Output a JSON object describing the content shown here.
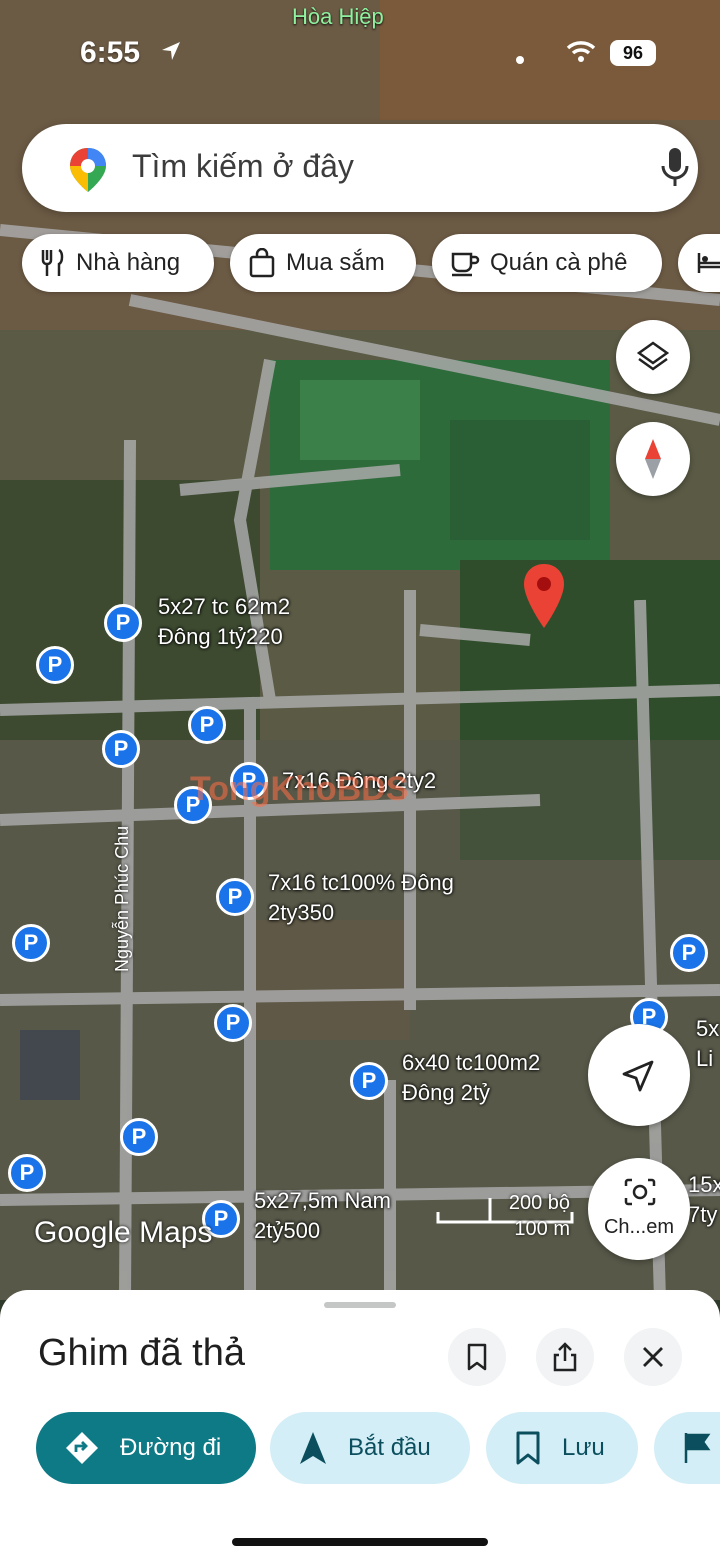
{
  "status_bar": {
    "time": "6:55",
    "battery": "96"
  },
  "map": {
    "top_place": "Hòa Hiệp",
    "road_label": "Nguyễn Phúc Chu",
    "watermark": "TongKhoBDS",
    "attribution": "Google Maps",
    "scale": {
      "imperial": "200 bộ",
      "metric": "100 m"
    },
    "listings": [
      "5x27 tc 62m2\nĐông 1tỷ220",
      "7x16 Đông 2ty2",
      "7x16 tc100% Đông\n2ty350",
      "6x40 tc100m2\nĐông 2tỷ",
      "5x27,5m Nam\n2tỷ500",
      "5x\nLi",
      "15x\n7ty"
    ],
    "parking_label": "P",
    "camera_label": "Ch...em"
  },
  "search": {
    "placeholder": "Tìm kiếm ở đây"
  },
  "chips": [
    {
      "label": "Nhà hàng",
      "icon": "restaurant-icon"
    },
    {
      "label": "Mua sắm",
      "icon": "shopping-bag-icon"
    },
    {
      "label": "Quán cà phê",
      "icon": "coffee-icon"
    },
    {
      "label": "",
      "icon": "hotel-icon"
    }
  ],
  "sheet": {
    "title": "Ghim đã thả",
    "actions": [
      {
        "label": "Đường đi",
        "icon": "directions-icon"
      },
      {
        "label": "Bắt đầu",
        "icon": "navigation-icon"
      },
      {
        "label": "Lưu",
        "icon": "bookmark-icon"
      },
      {
        "label": "",
        "icon": "flag-icon"
      }
    ]
  },
  "colors": {
    "accent": "#0e7a86",
    "chip_bg": "#d3eef6",
    "pin": "#ea4335",
    "parking": "#1a73e8"
  }
}
